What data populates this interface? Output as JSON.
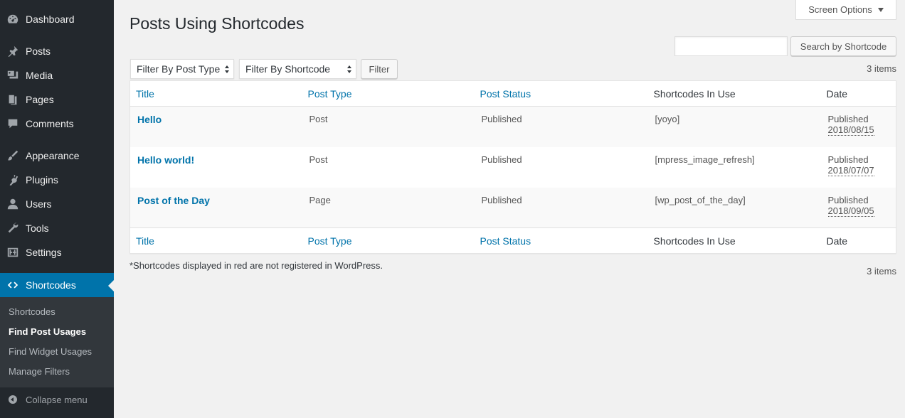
{
  "sidebar": {
    "items": [
      {
        "label": "Dashboard",
        "icon": "dashboard-icon"
      },
      {
        "label": "Posts",
        "icon": "pin-icon"
      },
      {
        "label": "Media",
        "icon": "media-icon"
      },
      {
        "label": "Pages",
        "icon": "pages-icon"
      },
      {
        "label": "Comments",
        "icon": "comment-icon"
      },
      {
        "label": "Appearance",
        "icon": "brush-icon"
      },
      {
        "label": "Plugins",
        "icon": "plugin-icon"
      },
      {
        "label": "Users",
        "icon": "user-icon"
      },
      {
        "label": "Tools",
        "icon": "wrench-icon"
      },
      {
        "label": "Settings",
        "icon": "settings-icon"
      },
      {
        "label": "Shortcodes",
        "icon": "code-icon"
      }
    ],
    "submenu": [
      "Shortcodes",
      "Find Post Usages",
      "Find Widget Usages",
      "Manage Filters"
    ],
    "collapse_label": "Collapse menu"
  },
  "header": {
    "title": "Posts Using Shortcodes",
    "screen_options": "Screen Options"
  },
  "search": {
    "value": "",
    "button": "Search by Shortcode"
  },
  "filters": {
    "post_type": "Filter By Post Type",
    "shortcode": "Filter By Shortcode",
    "filter_button": "Filter"
  },
  "items_count": "3 items",
  "table": {
    "columns": [
      "Title",
      "Post Type",
      "Post Status",
      "Shortcodes In Use",
      "Date"
    ],
    "rows": [
      {
        "title": "Hello",
        "type": "Post",
        "status": "Published",
        "shortcode": "[yoyo]",
        "unregistered": true,
        "date_status": "Published",
        "date": "2018/08/15"
      },
      {
        "title": "Hello world!",
        "type": "Post",
        "status": "Published",
        "shortcode": "[mpress_image_refresh]",
        "unregistered": true,
        "date_status": "Published",
        "date": "2018/07/07"
      },
      {
        "title": "Post of the Day",
        "type": "Page",
        "status": "Published",
        "shortcode": "[wp_post_of_the_day]",
        "unregistered": false,
        "date_status": "Published",
        "date": "2018/09/05"
      }
    ]
  },
  "footnote": "*Shortcodes displayed in red are not registered in WordPress.",
  "colors": {
    "sidebar_bg": "#23282d",
    "accent": "#0073aa",
    "unregistered": "#dc3232"
  }
}
